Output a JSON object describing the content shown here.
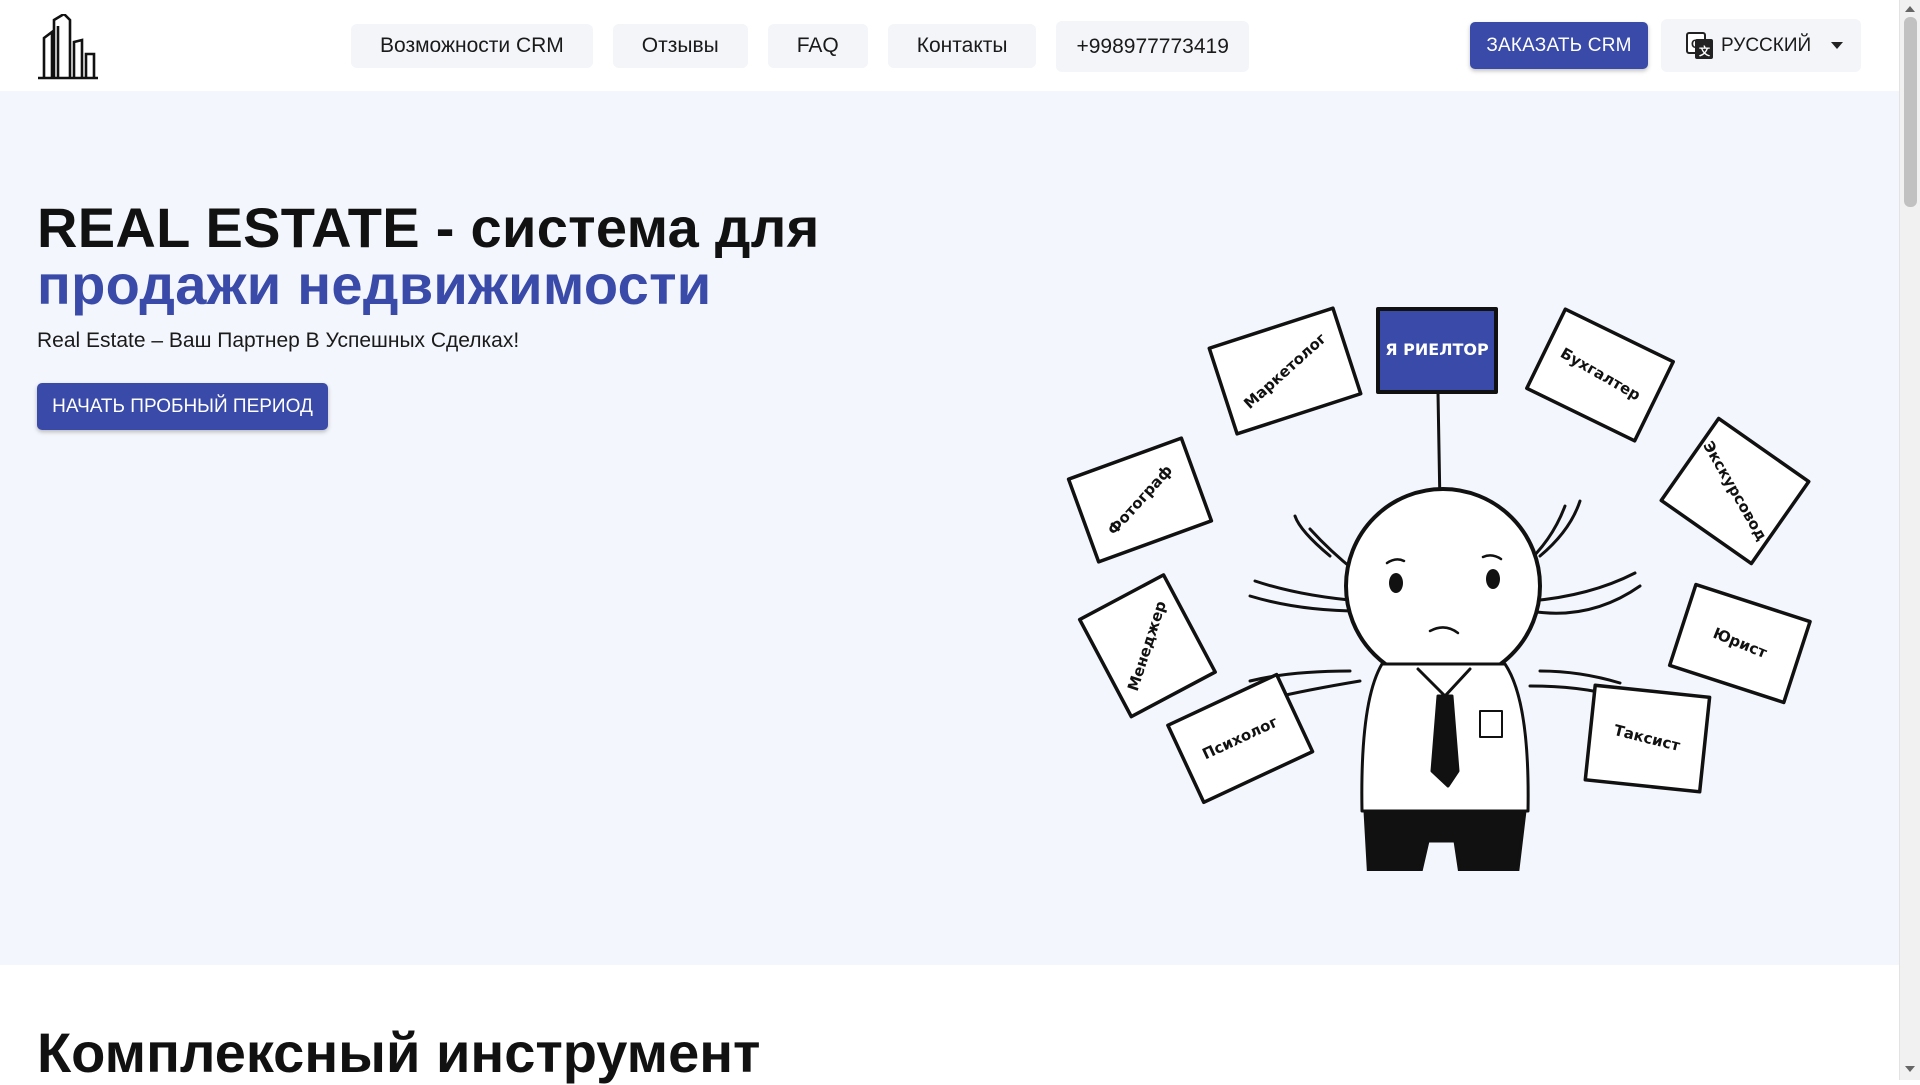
{
  "nav": {
    "items": [
      "Возможности CRM",
      "Отзывы",
      "FAQ",
      "Контакты"
    ],
    "phone": "+998977773419"
  },
  "header": {
    "order_label": "ЗАКАЗАТЬ CRM",
    "language": "РУССКИЙ"
  },
  "hero": {
    "title_line1": "REAL ESTATE - система для",
    "title_line2": "продажи недвижимости",
    "subtitle": "Real Estate – Ваш Партнер В Успешных Сделках!",
    "trial_label": "НАЧАТЬ ПРОБНЫЙ ПЕРИОД",
    "illustration": {
      "main_sign": "Я РИЕЛТОР",
      "signs": [
        "Маркетолог",
        "Бухгалтер",
        "Фотограф",
        "Экскурсовод",
        "Менеджер",
        "Юрист",
        "Психолог",
        "Таксист"
      ]
    }
  },
  "section2": {
    "title": "Комплексный инструмент"
  },
  "colors": {
    "accent": "#3a4aa8",
    "hero_bg": "#f3f6fc",
    "nav_bg": "#f3f5f9"
  }
}
